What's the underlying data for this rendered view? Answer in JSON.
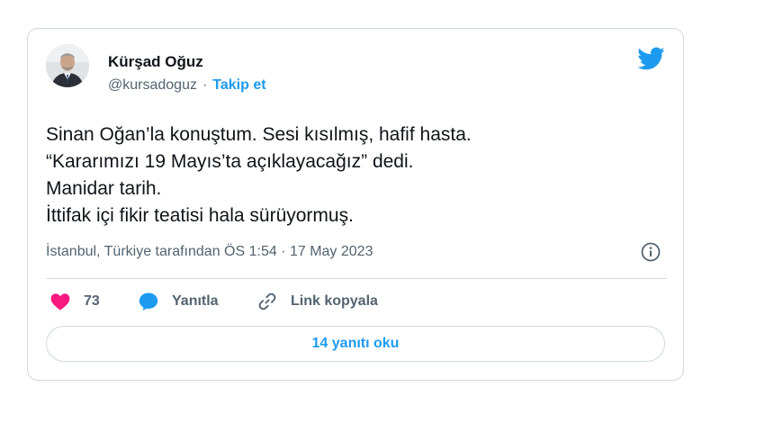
{
  "author": {
    "name": "Kürşad Oğuz",
    "handle": "@kursadoguz",
    "separator": "·",
    "follow_label": "Takip et"
  },
  "tweet": {
    "lines": [
      "Sinan Oğan’la konuştum. Sesi kısılmış, hafif hasta.",
      "“Kararımızı 19 Mayıs’ta açıklayacağız” dedi.",
      "Manidar tarih.",
      "İttifak içi fikir teatisi hala sürüyormuş."
    ],
    "meta": "İstanbul, Türkiye tarafından ÖS 1:54 · 17 May 2023"
  },
  "actions": {
    "like_count": "73",
    "reply_label": "Yanıtla",
    "copy_link_label": "Link kopyala"
  },
  "replies_button": "14 yanıtı oku",
  "colors": {
    "accent": "#1d9bf0",
    "like": "#f91880",
    "secondary_text": "#536471",
    "border": "#cfd9de"
  },
  "icons": {
    "brand": "twitter-bird-icon",
    "info": "info-icon",
    "like": "heart-icon",
    "reply": "speech-bubble-icon",
    "copy_link": "link-icon"
  }
}
